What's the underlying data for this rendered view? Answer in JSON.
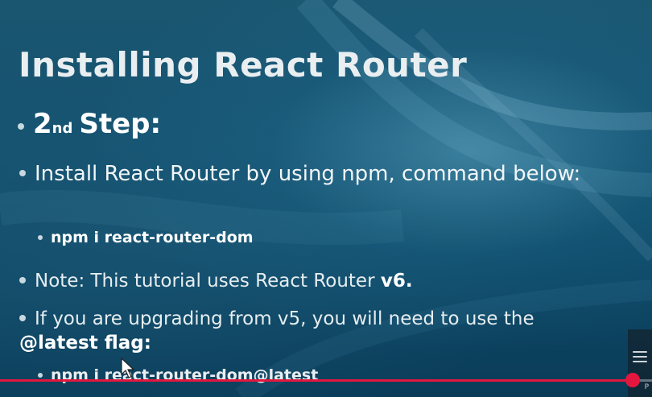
{
  "slide": {
    "title": "Installing React Router",
    "step": {
      "number": "2",
      "ordinal_suffix": "nd",
      "word": "Step:"
    },
    "install_text": "Install React Router by using npm, command below:",
    "install_command": "npm i react-router-dom",
    "note_prefix": "Note: This tutorial uses React Router",
    "note_version": "v6.",
    "upgrade_text": "If you are upgrading from v5, you will need to use the",
    "upgrade_flag": "@latest flag:",
    "upgrade_command": "npm i react-router-dom@latest"
  },
  "player": {
    "progress_fraction": 0.97,
    "progress_color": "#e3173e",
    "side_label": "P"
  },
  "icons": {
    "bullet": "filled-circle",
    "cursor": "mouse-pointer-icon",
    "side": "chapters-list-icon"
  }
}
